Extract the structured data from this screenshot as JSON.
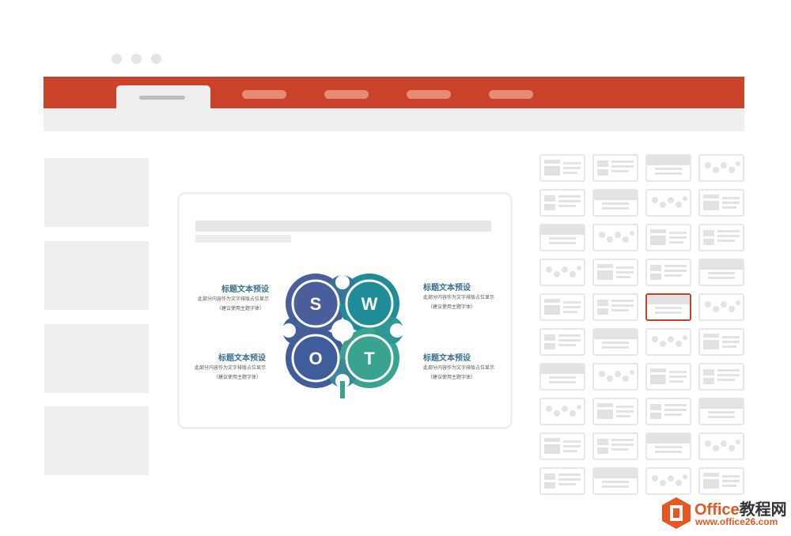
{
  "window": {
    "control_dots": [
      "dot-1",
      "dot-2",
      "dot-3"
    ]
  },
  "ribbon": {
    "color": "#c9432a",
    "tabs": [
      {
        "name": "active-tab",
        "active": true
      },
      {
        "name": "tab-2"
      },
      {
        "name": "tab-3"
      },
      {
        "name": "tab-4"
      },
      {
        "name": "tab-5"
      }
    ]
  },
  "slide": {
    "swot_letters": [
      "S",
      "W",
      "O",
      "T"
    ],
    "colors": {
      "S": "#4a5e9b",
      "W": "#1f8d98",
      "O": "#3f5d9a",
      "T": "#3aa38f",
      "heading": "#3b6f93"
    },
    "blocks": [
      {
        "title": "标题文本预设",
        "line1": "此部分内容作为文字排版占位显示",
        "line2": "（建议使用主题字体）"
      },
      {
        "title": "标题文本预设",
        "line1": "此部分内容作为文字排版占位显示",
        "line2": "（建议使用主题字体）"
      },
      {
        "title": "标题文本预设",
        "line1": "此部分内容作为文字排版占位显示",
        "line2": "（建议使用主题字体）"
      },
      {
        "title": "标题文本预设",
        "line1": "此部分内容作为文字排版占位显示",
        "line2": "（建议使用主题字体）"
      }
    ]
  },
  "layout_panel": {
    "rows": 10,
    "cols": 4,
    "selected": {
      "row": 4,
      "col": 2
    }
  },
  "watermark": {
    "brand": "Office",
    "brand_cn": "教程网",
    "url": "www.office26.com"
  }
}
